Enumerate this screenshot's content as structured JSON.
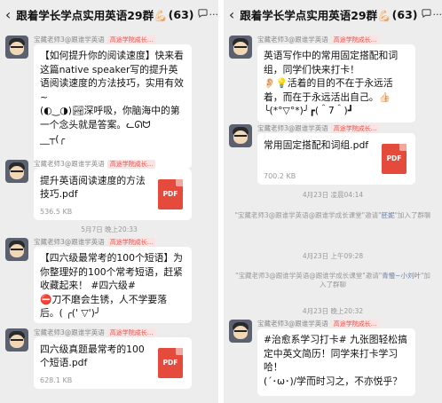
{
  "left": {
    "title": "跟着学长学点实用英语29群💪🏻",
    "count": "(63)",
    "sender": "宝藏老师3@跟谁学英语",
    "badge": "高途学院成长...",
    "msg1": "【如何提升你的阅读速度】快来看这篇native speaker写的提升英语阅读速度的方法技巧，实用有效~\n(◐‿◑)🏞深呼吸，你脑海中的第一个念头就是答案。ᓚᘏᗢ\n__┬(╭",
    "file1": {
      "name": "提升英语阅读速度的方法技巧.pdf",
      "size": "536.5 KB",
      "icon": "PDF"
    },
    "timestamp": "5月7日 晚上20:33",
    "msg2": "【四六级最常考的100个短语】为你整理好的100个常考短语，赶紧收藏起来！ #四六级#\n⛔刀不磨会生锈，人不学要落后。( ╭(' ▽')╯",
    "file2": {
      "name": "四六级真题最常考的100个短语.pdf",
      "size": "628.1 KB",
      "icon": "PDF"
    }
  },
  "right": {
    "title": "跟着学长学点实用英语29群💪🏻",
    "count": "(63)",
    "sender": "宝藏老师3@跟谁学英语",
    "badge": "高途学院成长...",
    "msg1": "英语写作中的常用固定搭配和词组，同学们快来打卡！\n👂🏻💡活着的目的不在于永远活着，而在于永远活出自己。👍🏻\n╰(*°▽°*)╯┏(＾7＾)┛",
    "file1": {
      "name": "常用固定搭配和词组.pdf",
      "size": "700.2 KB",
      "icon": "PDF"
    },
    "timestamp1": "4月23日 凌晨04:14",
    "sys1_a": "\"宝藏老师3@跟谁学英语@跟谁学成长课堂\"邀请\"",
    "sys1_b": "胚妮",
    "sys1_c": "\"加入了群聊",
    "timestamp2": "4月23日 上午09:28",
    "sys2_a": "\"宝藏老师3@跟谁学英语@跟谁学成长课堂\"邀请\"",
    "sys2_b": "青慢~小刘叶",
    "sys2_c": "\"加入了群聊",
    "timestamp3": "4月23日 晚上20:32",
    "msg2": "#治愈系学习打卡# 九张图轻松搞定中英文简历！同学来打卡学习哈！\n(´･ω･)/学而时习之，不亦悦乎？"
  },
  "colors": {
    "background": "#ededed",
    "bubble": "#ffffff",
    "pdf": "#e54b3c",
    "badge_text": "#e0574f"
  },
  "icons": {
    "back": "chevron-left-icon",
    "chat": "chat-bubble-icon",
    "more": "more-icon"
  }
}
